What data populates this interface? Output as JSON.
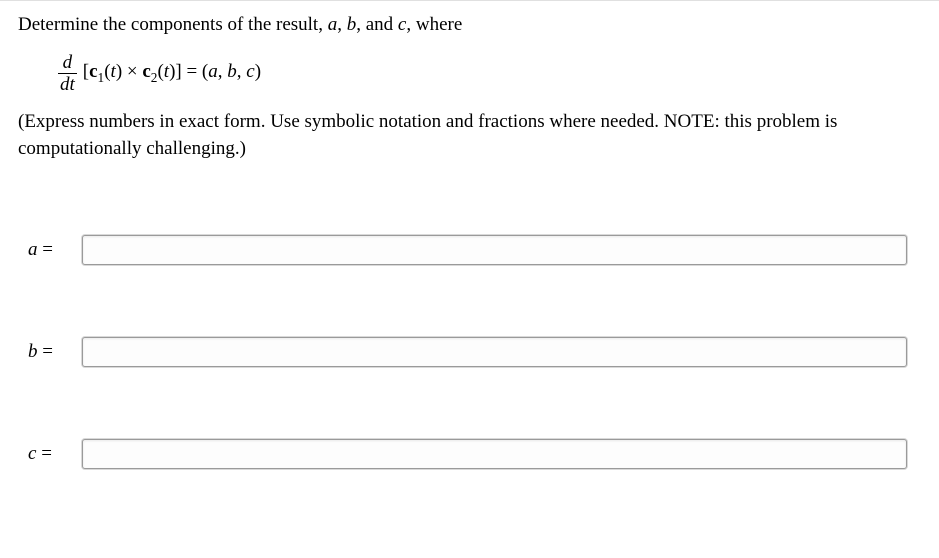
{
  "prompt": {
    "line1_pre": "Determine the components of the result, ",
    "a": "a",
    "sep1": ", ",
    "b": "b",
    "sep2": ", and ",
    "c": "c",
    "line1_post": ", where"
  },
  "equation": {
    "frac_num": "d",
    "frac_den": "dt",
    "body": "[c₁(t) × c₂(t)] = (a, b, c)"
  },
  "note": "(Express numbers in exact form. Use symbolic notation and fractions where needed. NOTE: this problem is computationally challenging.)",
  "answers": {
    "a_label": "a =",
    "b_label": "b =",
    "c_label": "c =",
    "a_value": "",
    "b_value": "",
    "c_value": ""
  }
}
